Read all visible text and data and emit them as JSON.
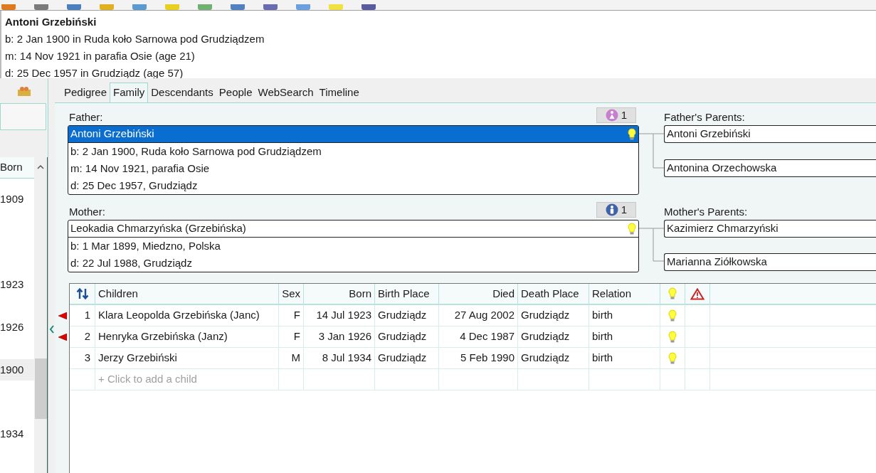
{
  "summary": {
    "name": "Antoni Grzebiński",
    "lines": [
      "b: 2 Jan 1900 in Ruda koło Sarnowa pod Grudziądzem",
      "m: 14 Nov 1921 in parafia Osie (age 21)",
      "d: 25 Dec 1957 in Grudziądz (age 57)"
    ]
  },
  "left_list": {
    "column": "Born",
    "rows": [
      {
        "born": "1909",
        "selected": false
      },
      {
        "selected": false
      },
      {
        "selected": false
      },
      {
        "selected": false
      },
      {
        "born": "1923",
        "selected": false
      },
      {
        "selected": false
      },
      {
        "born": "1926",
        "selected": false
      },
      {
        "selected": false
      },
      {
        "born": "1900",
        "selected": true
      },
      {
        "selected": false
      },
      {
        "selected": false
      },
      {
        "born": "1934",
        "selected": false
      }
    ]
  },
  "tabs": [
    {
      "label": "Pedigree",
      "selected": false
    },
    {
      "label": "Family",
      "selected": true
    },
    {
      "label": "Descendants",
      "selected": false
    },
    {
      "label": "People",
      "selected": false
    },
    {
      "label": "WebSearch",
      "selected": false
    },
    {
      "label": "Timeline",
      "selected": false
    }
  ],
  "partners": [
    {
      "label": "Father:",
      "badge": {
        "kind": "female",
        "count": "1"
      },
      "name": "Antoni Grzebiński",
      "selected": true,
      "note": true,
      "facts": [
        "b: 2 Jan 1900, Ruda koło Sarnowa pod Grudziądzem",
        "m: 14 Nov 1921, parafia Osie",
        "d: 25 Dec 1957, Grudziądz"
      ],
      "parents_label": "Father's Parents:",
      "parents": [
        "Antoni Grzebiński",
        "Antonina Orzechowska"
      ]
    },
    {
      "label": "Mother:",
      "badge": {
        "kind": "male",
        "count": "1"
      },
      "name": "Leokadia Chmarzyńska (Grzebińska)",
      "selected": false,
      "note": true,
      "facts": [
        "b: 1 Mar 1899, Miedzno, Polska",
        "d: 22 Jul 1988, Grudziądz"
      ],
      "parents_label": "Mother's Parents:",
      "parents": [
        "Kazimierz Chmarzyński",
        "Marianna Ziółkowska"
      ]
    }
  ],
  "children": {
    "columns": [
      "Children",
      "Sex",
      "Born",
      "Birth Place",
      "Died",
      "Death Place",
      "Relation"
    ],
    "rows": [
      {
        "flagged": true,
        "number": "1",
        "name": "Klara Leopolda Grzebińska (Janc)",
        "sex": "F",
        "born": "14 Jul 1923",
        "birth_place": "Grudziądz",
        "died": "27 Aug 2002",
        "death_place": "Grudziądz",
        "relation": "birth",
        "note": true
      },
      {
        "flagged": true,
        "number": "2",
        "name": "Henryka Grzebińska (Janz)",
        "sex": "F",
        "born": "3 Jan 1926",
        "birth_place": "Grudziądz",
        "died": "4 Dec 1987",
        "death_place": "Grudziądz",
        "relation": "birth",
        "note": true
      },
      {
        "flagged": false,
        "number": "3",
        "name": "Jerzy Grzebiński",
        "sex": "M",
        "born": "8 Jul 1934",
        "birth_place": "Grudziądz",
        "died": "5 Feb 1990",
        "death_place": "Grudziądz",
        "relation": "birth",
        "note": true
      }
    ],
    "add_placeholder": "+ Click to add a child"
  }
}
